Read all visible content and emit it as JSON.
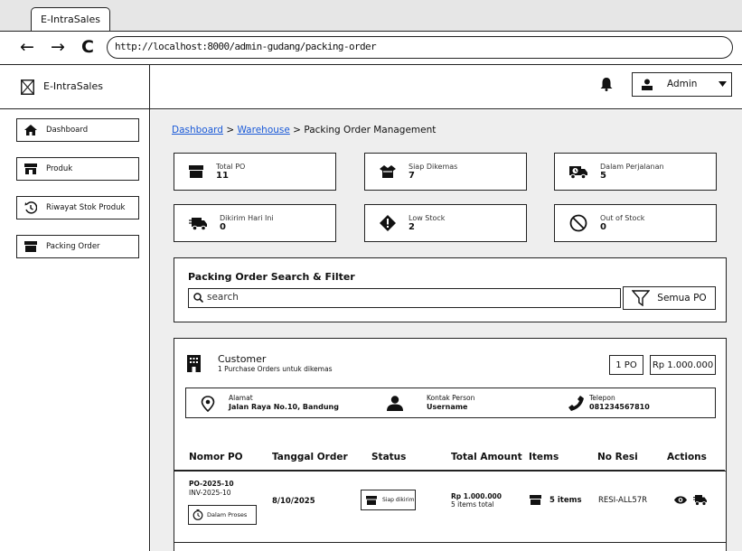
{
  "browser": {
    "tab_title": "E-IntraSales",
    "back": "←",
    "forward": "→",
    "reload": "C",
    "url": "http://localhost:8000/admin-gudang/packing-order"
  },
  "brand": "E-IntraSales",
  "user": {
    "name": "Admin"
  },
  "sidebar": {
    "items": [
      {
        "label": "Dashboard",
        "icon": "home-icon"
      },
      {
        "label": "Produk",
        "icon": "store-icon"
      },
      {
        "label": "Riwayat Stok Produk",
        "icon": "history-icon"
      },
      {
        "label": "Packing Order",
        "icon": "box-icon"
      }
    ]
  },
  "breadcrumb": {
    "home": "Dashboard",
    "sep1": ">",
    "warehouse": "Warehouse",
    "sep2": ">",
    "current": "Packing Order Management"
  },
  "stats": [
    {
      "label": "Total PO",
      "value": "11",
      "icon": "box-icon"
    },
    {
      "label": "Siap Dikemas",
      "value": "7",
      "icon": "open-box-icon"
    },
    {
      "label": "Dalam Perjalanan",
      "value": "5",
      "icon": "truck-clock-icon"
    },
    {
      "label": "Dikirim Hari Ini",
      "value": "0",
      "icon": "fast-truck-icon"
    },
    {
      "label": "Low Stock",
      "value": "2",
      "icon": "warning-diamond-icon"
    },
    {
      "label": "Out of Stock",
      "value": "0",
      "icon": "ban-icon"
    }
  ],
  "filter": {
    "title": "Packing Order Search & Filter",
    "search_placeholder": "search",
    "filter_label": "Semua PO"
  },
  "customer": {
    "title": "Customer",
    "subtitle": "1 Purchase Orders untuk dikemas",
    "po_count": "1 PO",
    "total": "Rp 1.000.000",
    "address_label": "Alamat",
    "address": "Jalan Raya No.10, Bandung",
    "contact_label": "Kontak Person",
    "contact": "Username",
    "phone_label": "Telepon",
    "phone": "081234567810"
  },
  "table": {
    "headers": [
      "Nomor PO",
      "Tanggal Order",
      "Status",
      "Total Amount",
      "Items",
      "No Resi",
      "Actions"
    ],
    "rows": [
      {
        "po": "PO-2025-10",
        "inv": "INV-2025-10",
        "process_status": "Dalam Proses",
        "date": "8/10/2025",
        "status": "Siap dikirim",
        "amount": "Rp 1.000.000",
        "amount_note": "5 items total",
        "items": "5 items",
        "resi": "RESI-ALL57R"
      }
    ]
  }
}
